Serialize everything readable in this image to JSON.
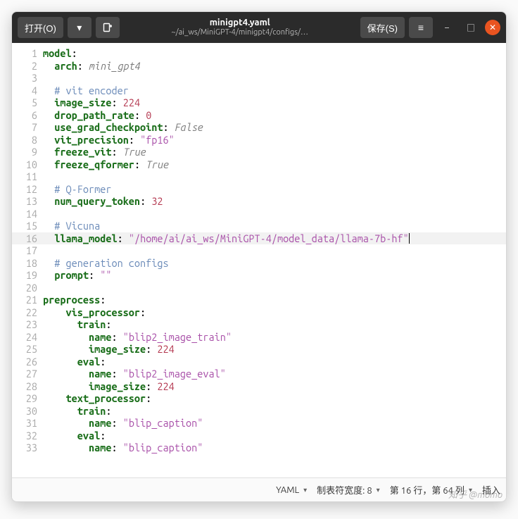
{
  "header": {
    "open_label": "打开(O)",
    "save_label": "保存(S)",
    "title": "minigpt4.yaml",
    "subtitle": "~/ai_ws/MiniGPT-4/minigpt4/configs/…"
  },
  "status": {
    "language": "YAML",
    "tab_width_label": "制表符宽度: 8",
    "cursor_pos": "第 16 行，第 64 列",
    "ins_mode": "插入"
  },
  "highlight_line": 16,
  "lines": [
    {
      "n": 1,
      "i": 0,
      "t": "key",
      "k": "model",
      "v": null
    },
    {
      "n": 2,
      "i": 1,
      "t": "key",
      "k": "arch",
      "v": {
        "cls": "tk-bool",
        "text": "mini_gpt4"
      }
    },
    {
      "n": 3,
      "i": 0,
      "t": "blank"
    },
    {
      "n": 4,
      "i": 1,
      "t": "cmt",
      "text": "# vit encoder"
    },
    {
      "n": 5,
      "i": 1,
      "t": "key",
      "k": "image_size",
      "v": {
        "cls": "tk-num",
        "text": "224"
      }
    },
    {
      "n": 6,
      "i": 1,
      "t": "key",
      "k": "drop_path_rate",
      "v": {
        "cls": "tk-num",
        "text": "0"
      }
    },
    {
      "n": 7,
      "i": 1,
      "t": "key",
      "k": "use_grad_checkpoint",
      "v": {
        "cls": "tk-bool",
        "text": "False"
      }
    },
    {
      "n": 8,
      "i": 1,
      "t": "key",
      "k": "vit_precision",
      "v": {
        "cls": "tk-str",
        "text": "\"fp16\""
      }
    },
    {
      "n": 9,
      "i": 1,
      "t": "key",
      "k": "freeze_vit",
      "v": {
        "cls": "tk-bool",
        "text": "True"
      }
    },
    {
      "n": 10,
      "i": 1,
      "t": "key",
      "k": "freeze_qformer",
      "v": {
        "cls": "tk-bool",
        "text": "True"
      }
    },
    {
      "n": 11,
      "i": 0,
      "t": "blank"
    },
    {
      "n": 12,
      "i": 1,
      "t": "cmt",
      "text": "# Q-Former"
    },
    {
      "n": 13,
      "i": 1,
      "t": "key",
      "k": "num_query_token",
      "v": {
        "cls": "tk-num",
        "text": "32"
      }
    },
    {
      "n": 14,
      "i": 0,
      "t": "blank"
    },
    {
      "n": 15,
      "i": 1,
      "t": "cmt",
      "text": "# Vicuna"
    },
    {
      "n": 16,
      "i": 1,
      "t": "key",
      "k": "llama_model",
      "v": {
        "cls": "tk-str",
        "text": "\"/home/ai/ai_ws/MiniGPT-4/model_data/llama-7b-hf\""
      },
      "cursor": true
    },
    {
      "n": 17,
      "i": 0,
      "t": "blank"
    },
    {
      "n": 18,
      "i": 1,
      "t": "cmt",
      "text": "# generation configs"
    },
    {
      "n": 19,
      "i": 1,
      "t": "key",
      "k": "prompt",
      "v": {
        "cls": "tk-str",
        "text": "\"\""
      }
    },
    {
      "n": 20,
      "i": 0,
      "t": "blank"
    },
    {
      "n": 21,
      "i": 0,
      "t": "key",
      "k": "preprocess",
      "v": null
    },
    {
      "n": 22,
      "i": 2,
      "t": "key",
      "k": "vis_processor",
      "v": null
    },
    {
      "n": 23,
      "i": 3,
      "t": "key",
      "k": "train",
      "v": null
    },
    {
      "n": 24,
      "i": 4,
      "t": "key",
      "k": "name",
      "v": {
        "cls": "tk-str",
        "text": "\"blip2_image_train\""
      }
    },
    {
      "n": 25,
      "i": 4,
      "t": "key",
      "k": "image_size",
      "v": {
        "cls": "tk-num",
        "text": "224"
      }
    },
    {
      "n": 26,
      "i": 3,
      "t": "key",
      "k": "eval",
      "v": null
    },
    {
      "n": 27,
      "i": 4,
      "t": "key",
      "k": "name",
      "v": {
        "cls": "tk-str",
        "text": "\"blip2_image_eval\""
      }
    },
    {
      "n": 28,
      "i": 4,
      "t": "key",
      "k": "image_size",
      "v": {
        "cls": "tk-num",
        "text": "224"
      }
    },
    {
      "n": 29,
      "i": 2,
      "t": "key",
      "k": "text_processor",
      "v": null
    },
    {
      "n": 30,
      "i": 3,
      "t": "key",
      "k": "train",
      "v": null
    },
    {
      "n": 31,
      "i": 4,
      "t": "key",
      "k": "name",
      "v": {
        "cls": "tk-str",
        "text": "\"blip_caption\""
      }
    },
    {
      "n": 32,
      "i": 3,
      "t": "key",
      "k": "eval",
      "v": null
    },
    {
      "n": 33,
      "i": 4,
      "t": "key",
      "k": "name",
      "v": {
        "cls": "tk-str",
        "text": "\"blip_caption\""
      }
    }
  ],
  "watermark": "知乎 @momo"
}
